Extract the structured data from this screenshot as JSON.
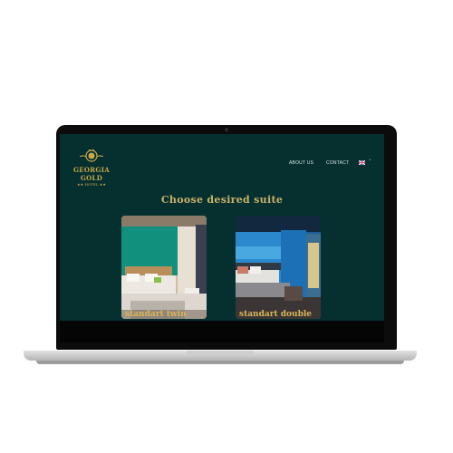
{
  "logo": {
    "name": "GEORGIA GOLD",
    "sub": "★★ HOTEL ★★"
  },
  "nav": {
    "about": "ABOUT US",
    "contact": "CONTACT",
    "lang_caret": "˅"
  },
  "headline": "Choose desired suite",
  "suites": [
    {
      "label": "standart twin"
    },
    {
      "label": "standart double"
    }
  ],
  "colors": {
    "background": "#05302f",
    "gold": "#c9a74a"
  }
}
